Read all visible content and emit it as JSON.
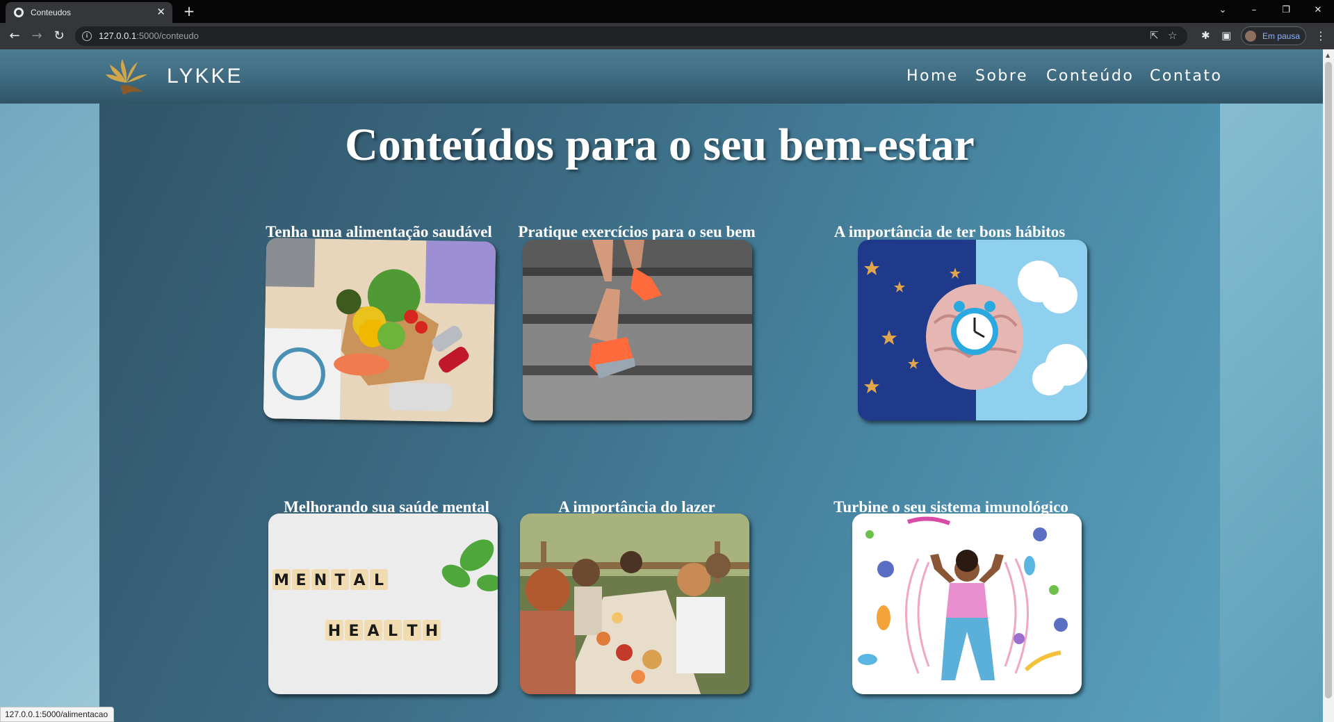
{
  "browser": {
    "tab_title": "Conteudos",
    "tab_close": "✕",
    "new_tab": "+",
    "url_host": "127.0.0.1",
    "url_rest": ":5000/conteudo",
    "profile_label": "Em pausa",
    "status_url": "127.0.0.1:5000/alimentacao",
    "window_controls": {
      "tab_search": "⌄",
      "minimize": "–",
      "restore": "❐",
      "close": "✕"
    },
    "nav_icons": {
      "back": "←",
      "forward": "→",
      "reload": "↻"
    },
    "toolbar_icons": {
      "share": "⇱",
      "star": "☆",
      "extensions": "✱",
      "sidepanel": "▣",
      "menu": "⋮"
    }
  },
  "site": {
    "brand": "LYKKE",
    "nav": [
      "Home",
      "Sobre",
      "Conteúdo",
      "Contato"
    ],
    "page_title": "Conteúdos para o seu bem-estar",
    "cards": [
      {
        "title": "Tenha uma alimentação saudável",
        "image": "healthy-food-photo"
      },
      {
        "title": "Pratique exercícios para o seu bem",
        "image": "running-stairs-photo"
      },
      {
        "title": "A importância de ter bons hábitos",
        "image": "brain-clock-illustration"
      },
      {
        "title": "Melhorando sua saúde mental",
        "image": "mental-health-tiles-photo",
        "tile_words": [
          "MENTAL",
          "HEALTH"
        ]
      },
      {
        "title": "A importância do lazer",
        "image": "friends-picnic-photo"
      },
      {
        "title": "Turbine o seu sistema imunológico",
        "image": "immune-system-illustration"
      }
    ]
  },
  "colors": {
    "header": "#3e6a80",
    "main_panel": "#3b6a82",
    "logo_gold": "#d2a64a",
    "logo_brown": "#8a5a2b",
    "profile_text": "#8ab4f8"
  }
}
